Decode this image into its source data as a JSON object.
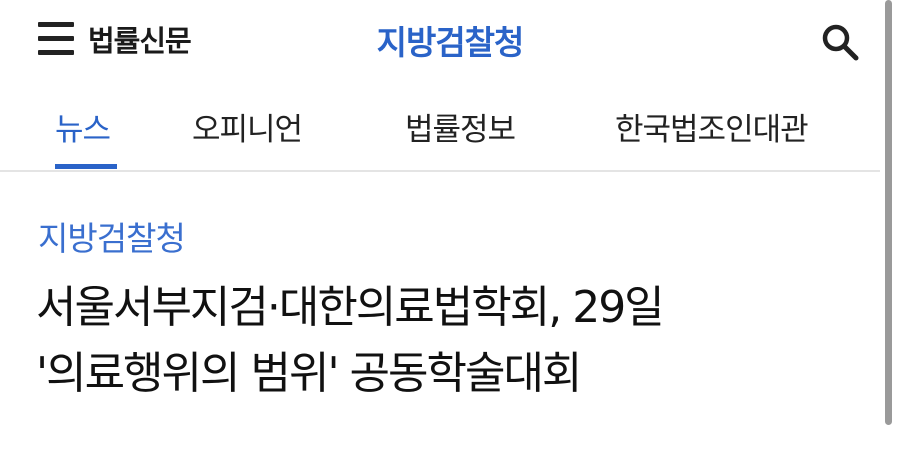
{
  "header": {
    "menu_icon": "hamburger-menu-icon",
    "brand_name": "법률신문",
    "section_title": "지방검찰청",
    "search_icon": "search-icon",
    "accent_color": "#2a63c8"
  },
  "nav": {
    "tabs": [
      {
        "label": "뉴스",
        "active": true
      },
      {
        "label": "오피니언",
        "active": false
      },
      {
        "label": "법률정보",
        "active": false
      },
      {
        "label": "한국법조인대관",
        "active": false
      }
    ]
  },
  "article": {
    "category": "지방검찰청",
    "headline_lines": [
      "서울서부지검·대한의료법학회, 29일",
      "'의료행위의 범위' 공동학술대회"
    ]
  }
}
